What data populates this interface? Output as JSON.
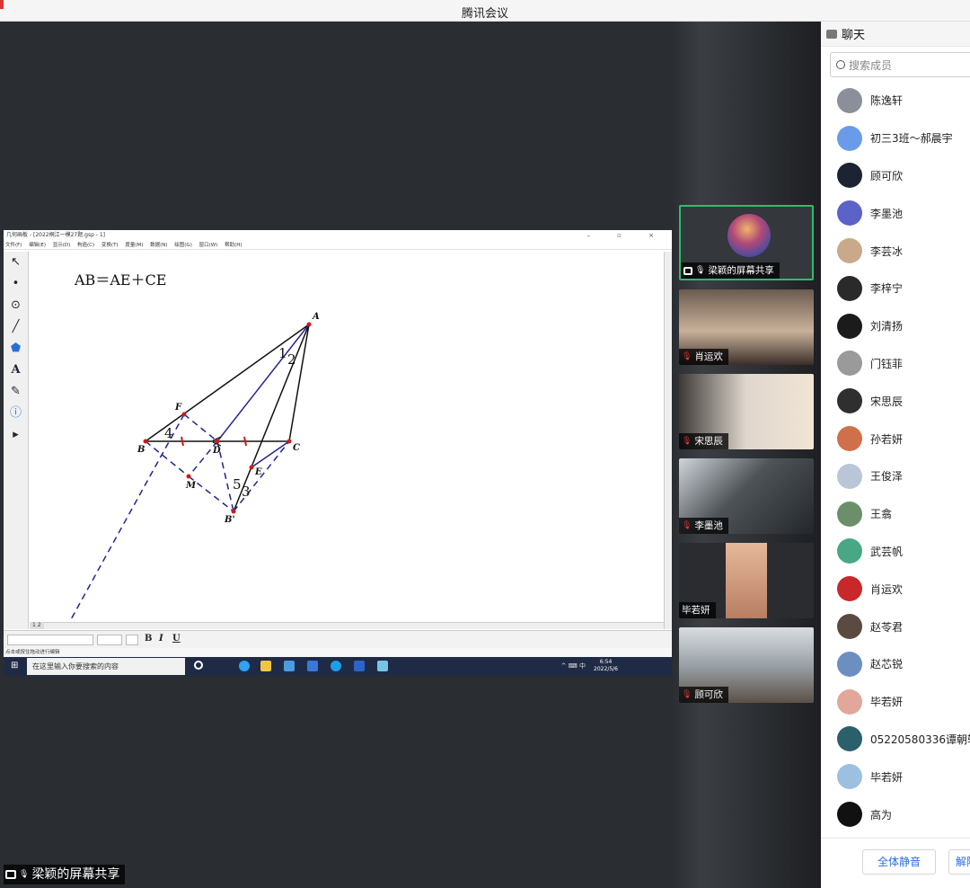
{
  "window": {
    "title": "腾讯会议"
  },
  "shared_app": {
    "title": "几何画板 - [2022桐江一模27题.gsp - 1]",
    "menu": [
      "文件(F)",
      "编辑(E)",
      "显示(D)",
      "构造(C)",
      "变换(T)",
      "度量(M)",
      "数据(N)",
      "绘图(G)",
      "窗口(W)",
      "帮助(H)"
    ],
    "tools": [
      "↖",
      "•",
      "⊙",
      "╱",
      "⬟",
      "A",
      "✎",
      "ⓘ",
      "▸"
    ],
    "formula": "AB＝AE＋CE",
    "points": [
      "A",
      "F",
      "B",
      "D",
      "C",
      "E",
      "M",
      "B'"
    ],
    "angle_labels": [
      "1",
      "2",
      "4",
      "5",
      "3"
    ],
    "pages": "1 2",
    "format_buttons": [
      "B",
      "I",
      "U"
    ],
    "status": "点击或按住拖动进行编辑"
  },
  "taskbar": {
    "search_placeholder": "在这里输入你要搜索的内容",
    "time": "6:54",
    "date": "2022/5/6",
    "tray": "^ ⌨ 中"
  },
  "share_label": "梁颖的屏幕共享",
  "videos": [
    {
      "name": "梁颖的屏幕共享",
      "active": true
    },
    {
      "name": "肖运欢",
      "active": false
    },
    {
      "name": "宋思辰",
      "active": false
    },
    {
      "name": "李墨池",
      "active": false
    },
    {
      "name": "毕若妍",
      "active": false
    },
    {
      "name": "顾可欣",
      "active": false
    }
  ],
  "panel": {
    "header": "聊天",
    "search_placeholder": "搜索成员",
    "members": [
      {
        "name": "陈逸轩",
        "color": "#8a8f99"
      },
      {
        "name": "初三3班～郝晨宇",
        "color": "#6a9be8"
      },
      {
        "name": "顾可欣",
        "color": "#1c2333"
      },
      {
        "name": "李墨池",
        "color": "#5b63c9"
      },
      {
        "name": "李芸冰",
        "color": "#c9a98a"
      },
      {
        "name": "李梓宁",
        "color": "#2a2a2a"
      },
      {
        "name": "刘清扬",
        "color": "#1b1b1b"
      },
      {
        "name": "门钰菲",
        "color": "#9a9a9a"
      },
      {
        "name": "宋思辰",
        "color": "#2f2f2f"
      },
      {
        "name": "孙若妍",
        "color": "#d0704a"
      },
      {
        "name": "王俊泽",
        "color": "#b9c6d8"
      },
      {
        "name": "王翕",
        "color": "#6b8f6a"
      },
      {
        "name": "武芸帆",
        "color": "#4aa785"
      },
      {
        "name": "肖运欢",
        "color": "#c8282a"
      },
      {
        "name": "赵苓君",
        "color": "#5a4a40"
      },
      {
        "name": "赵芯锐",
        "color": "#6c8fc2"
      },
      {
        "name": "毕若妍",
        "color": "#e1a79a"
      },
      {
        "name": "05220580336谭朝轩",
        "color": "#2b5f6b"
      },
      {
        "name": "毕若妍",
        "color": "#9ec0e0"
      },
      {
        "name": "高为",
        "color": "#111111"
      }
    ],
    "mute_all": "全体静音",
    "unmute_all": "解除"
  }
}
